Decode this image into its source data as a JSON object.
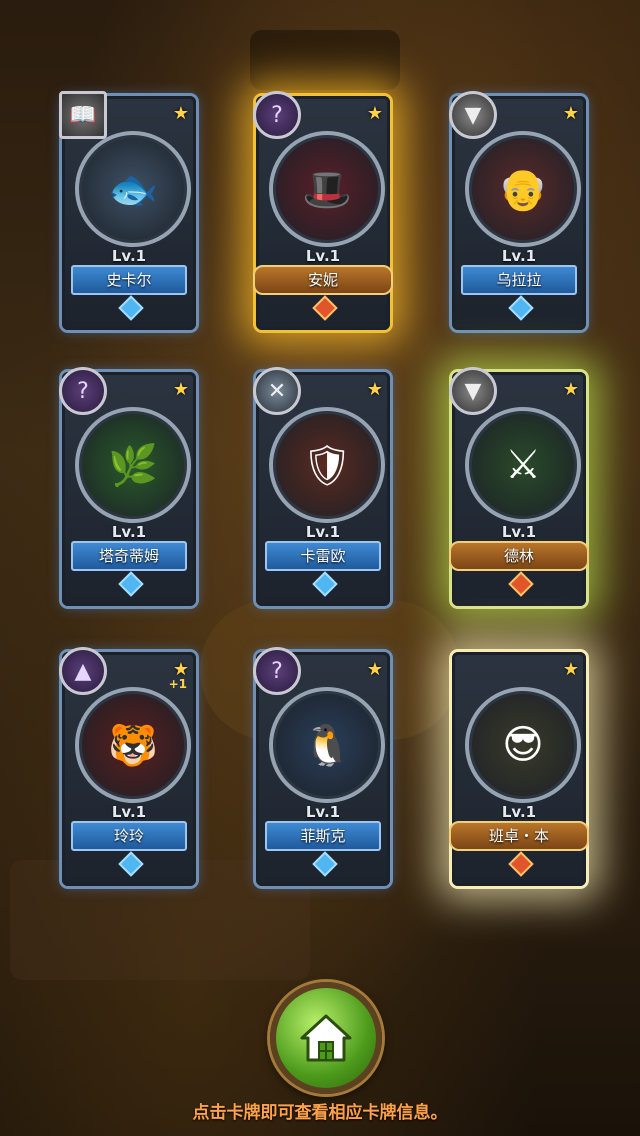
{
  "cards": [
    {
      "id": "c1",
      "class_icon": "book-icon",
      "class_glyph": "📖",
      "class_style": "book",
      "glow": "blue",
      "name": "史卡尔",
      "level": "Lv.1",
      "portrait_bg": "#3e5166",
      "portrait_glyph": "🐟",
      "star": "★",
      "plus": ""
    },
    {
      "id": "c2",
      "class_icon": "magic-icon",
      "class_glyph": "?",
      "class_style": "",
      "glow": "gold",
      "name": "安妮",
      "level": "Lv.1",
      "portrait_bg": "#5a1f28",
      "portrait_glyph": "🎩",
      "star": "★",
      "plus": ""
    },
    {
      "id": "c3",
      "class_icon": "wing-icon",
      "class_glyph": "▼",
      "class_style": "wing",
      "glow": "blue",
      "name": "乌拉拉",
      "level": "Lv.1",
      "portrait_bg": "#5a2a2a",
      "portrait_glyph": "👴",
      "star": "★",
      "plus": ""
    },
    {
      "id": "c4",
      "class_icon": "magic-icon",
      "class_glyph": "?",
      "class_style": "",
      "glow": "blue",
      "name": "塔奇蒂姆",
      "level": "Lv.1",
      "portrait_bg": "#2a5a2a",
      "portrait_glyph": "🌿",
      "star": "★",
      "plus": ""
    },
    {
      "id": "c5",
      "class_icon": "sword-icon",
      "class_glyph": "✕",
      "class_style": "sword",
      "glow": "blue",
      "name": "卡雷欧",
      "level": "Lv.1",
      "portrait_bg": "#5a2a20",
      "portrait_glyph": "🛡",
      "star": "★",
      "plus": ""
    },
    {
      "id": "c6",
      "class_icon": "wing-icon",
      "class_glyph": "▼",
      "class_style": "wing",
      "glow": "green",
      "name": "德林",
      "level": "Lv.1",
      "portrait_bg": "#2a4a2a",
      "portrait_glyph": "⚔",
      "star": "★",
      "plus": ""
    },
    {
      "id": "c7",
      "class_icon": "witch-hat-icon",
      "class_glyph": "▲",
      "class_style": "",
      "glow": "blue",
      "name": "玲玲",
      "level": "Lv.1",
      "portrait_bg": "#5a1f1f",
      "portrait_glyph": "🐯",
      "star": "★",
      "plus": "+1"
    },
    {
      "id": "c8",
      "class_icon": "magic-icon",
      "class_glyph": "?",
      "class_style": "",
      "glow": "blue",
      "name": "菲斯克",
      "level": "Lv.1",
      "portrait_bg": "#2a3f5a",
      "portrait_glyph": "🐧",
      "star": "★",
      "plus": ""
    },
    {
      "id": "c9",
      "class_icon": "",
      "class_glyph": "",
      "class_style": "",
      "glow": "white",
      "name": "班卓・本",
      "level": "Lv.1",
      "portrait_bg": "#3a3a2a",
      "portrait_glyph": "😎",
      "star": "★",
      "plus": ""
    }
  ],
  "home_button_icon": "home-icon",
  "hint_text": "点击卡牌即可查看相应卡牌信息。",
  "colors": {
    "hint": "#ffa14a",
    "blue_frame": "#6d8fb8",
    "gold_glow": "#f2c13a",
    "green_glow": "#d8e28a",
    "white_glow": "#f7edb8",
    "home_green": "#4c9a1b"
  }
}
